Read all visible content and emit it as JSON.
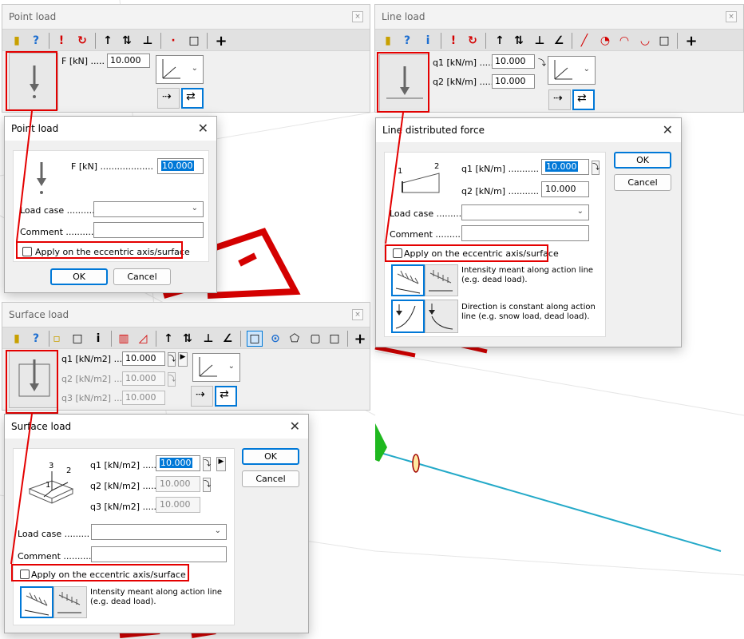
{
  "colors": {
    "highlight": "#e40000",
    "accent": "#0078d7",
    "beam": "#23a9c8",
    "red_member": "#d40000"
  },
  "point_panel": {
    "title": "Point load",
    "close": "×",
    "f_label": "F [kN] .....",
    "f_value": "10.000"
  },
  "line_panel": {
    "title": "Line load",
    "close": "×",
    "q1_label": "q1 [kN/m] .....",
    "q1_value": "10.000",
    "q2_label": "q2 [kN/m] .....",
    "q2_value": "10.000"
  },
  "surface_panel": {
    "title": "Surface load",
    "close": "×",
    "q1_label": "q1 [kN/m2] ...",
    "q1_value": "10.000",
    "q2_label": "q2 [kN/m2] ...",
    "q2_value": "10.000",
    "q3_label": "q3 [kN/m2] ...",
    "q3_value": "10.000"
  },
  "point_dialog": {
    "title": "Point load",
    "close": "✕",
    "f_label": "F [kN] ...................",
    "f_value": "10.000",
    "loadcase_label": "Load case ..........",
    "comment_label": "Comment ..........",
    "eccentric_label": "Apply on the eccentric axis/surface",
    "ok": "OK",
    "cancel": "Cancel"
  },
  "line_dialog": {
    "title": "Line distributed force",
    "close": "✕",
    "n1": "1",
    "n2": "2",
    "q1_label": "q1 [kN/m] ...........",
    "q1_value": "10.000",
    "q2_label": "q2 [kN/m] ...........",
    "q2_value": "10.000",
    "loadcase_label": "Load case ..........",
    "comment_label": "Comment ...........",
    "eccentric_label": "Apply on the eccentric axis/surface",
    "ok": "OK",
    "cancel": "Cancel",
    "desc1": "Intensity meant along action line (e.g. dead load).",
    "desc2": "Direction is constant along action line (e.g. snow load, dead load)."
  },
  "surface_dialog": {
    "title": "Surface load",
    "close": "✕",
    "n3": "3",
    "n2": "2",
    "n1": "1",
    "q1_label": "q1 [kN/m2] .....",
    "q1_value": "10.000",
    "q2_label": "q2 [kN/m2] .....",
    "q2_value": "10.000",
    "q3_label": "q3 [kN/m2] .....",
    "q3_value": "10.000",
    "loadcase_label": "Load case .........",
    "comment_label": "Comment ...........",
    "eccentric_label": "Apply on the eccentric axis/surface",
    "ok": "OK",
    "cancel": "Cancel",
    "desc1": "Intensity meant along action line (e.g. dead load)."
  }
}
